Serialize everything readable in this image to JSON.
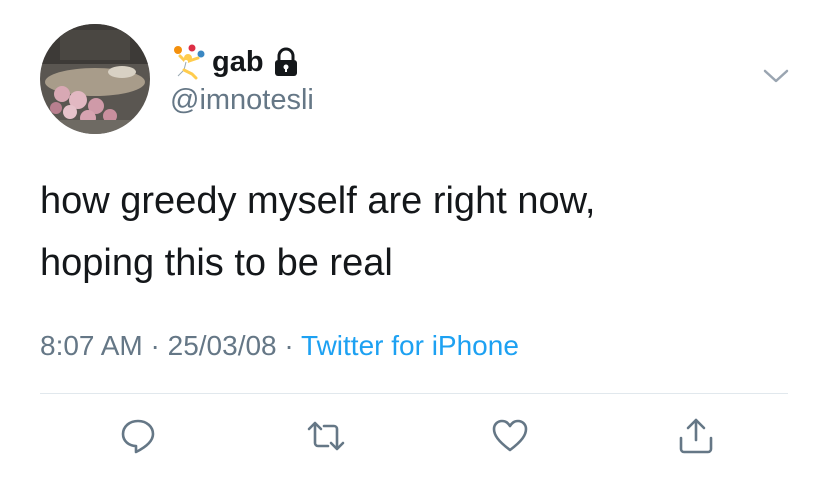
{
  "user": {
    "display_name": "gab",
    "handle": "@imnotesli",
    "emoji_icon": "person-juggling-emoji",
    "verified_icon": "lock-icon"
  },
  "tweet": {
    "lines": [
      "how greedy myself are right now,",
      "hoping this to be real"
    ]
  },
  "meta": {
    "time": "8:07 AM",
    "separator": "·",
    "date": "25/03/08",
    "source": "Twitter for iPhone"
  },
  "actions": [
    "reply-icon",
    "retweet-icon",
    "like-icon",
    "share-icon"
  ],
  "colors": {
    "text": "#14171a",
    "secondary": "#657786",
    "accent": "#1da1f2",
    "divider": "#e1e8ed"
  }
}
